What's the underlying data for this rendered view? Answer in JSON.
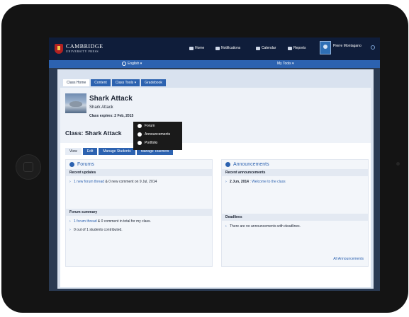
{
  "brand": {
    "line1": "CAMBRIDGE",
    "line2": "UNIVERSITY PRESS"
  },
  "topnav": {
    "home": "Home",
    "notifications": "Notifications",
    "calendar": "Calendar",
    "reports": "Reports"
  },
  "user": {
    "name": "Pierre Montagano"
  },
  "langbar": {
    "language": "English ▾",
    "mytools": "My Tools ▾"
  },
  "tabs": [
    "Class Home",
    "Content",
    "Class Tools ▾",
    "Gradebook"
  ],
  "dropdown": [
    "Forum",
    "Announcements",
    "Portfolio"
  ],
  "class": {
    "title": "Shark Attack",
    "subtitle": "Shark Attack",
    "expires": "Class expires: 2 Feb, 2015",
    "heading": "Class: Shark Attack"
  },
  "subtabs": [
    "View",
    "Edit",
    "Manage Students",
    "Manage Teachers"
  ],
  "forums": {
    "title": "Forums",
    "recent_title": "Recent updates",
    "recent_link": "1 new forum thread",
    "recent_rest": " & 0 new comment on 9 Jul, 2014",
    "summary_title": "Forum summary",
    "summary_link": "1 forum thread",
    "summary_rest": " & 0 comment in total for my class.",
    "contrib": "0 out of 1 students contributed."
  },
  "announcements": {
    "title": "Announcements",
    "recent_title": "Recent announcements",
    "date": "2 Jun, 2014",
    "sep": " : ",
    "link": "Welcome to the class",
    "deadlines_title": "Deadlines",
    "no_deadlines": "There are no announcements with deadlines.",
    "all_link": "All Announcements"
  },
  "colors": {
    "primary": "#2c62b0",
    "topbar": "#0f1d3a",
    "tablet": "#141414"
  }
}
